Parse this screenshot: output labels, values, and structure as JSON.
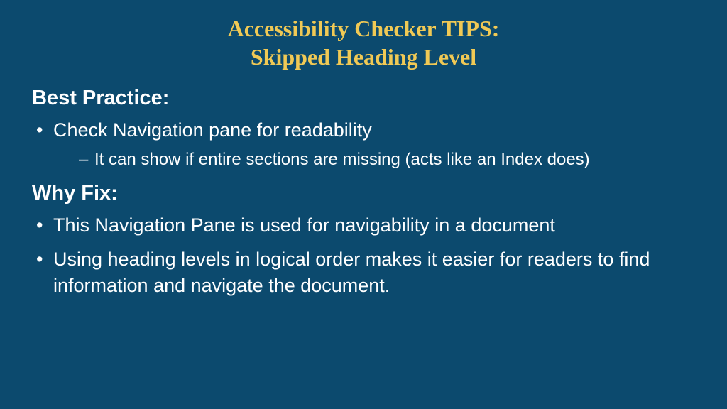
{
  "title_line1": "Accessibility Checker TIPS:",
  "title_line2": "Skipped Heading Level",
  "sections": {
    "best_practice": {
      "heading": "Best Practice:",
      "bullet1": "Check Navigation pane for readability",
      "sub1": "It can show if entire sections are missing (acts like an Index does)"
    },
    "why_fix": {
      "heading": "Why Fix:",
      "bullet1": "This Navigation Pane is used for navigability in a document",
      "bullet2": "Using heading levels in logical order makes it easier for readers to find information and navigate the document."
    }
  }
}
